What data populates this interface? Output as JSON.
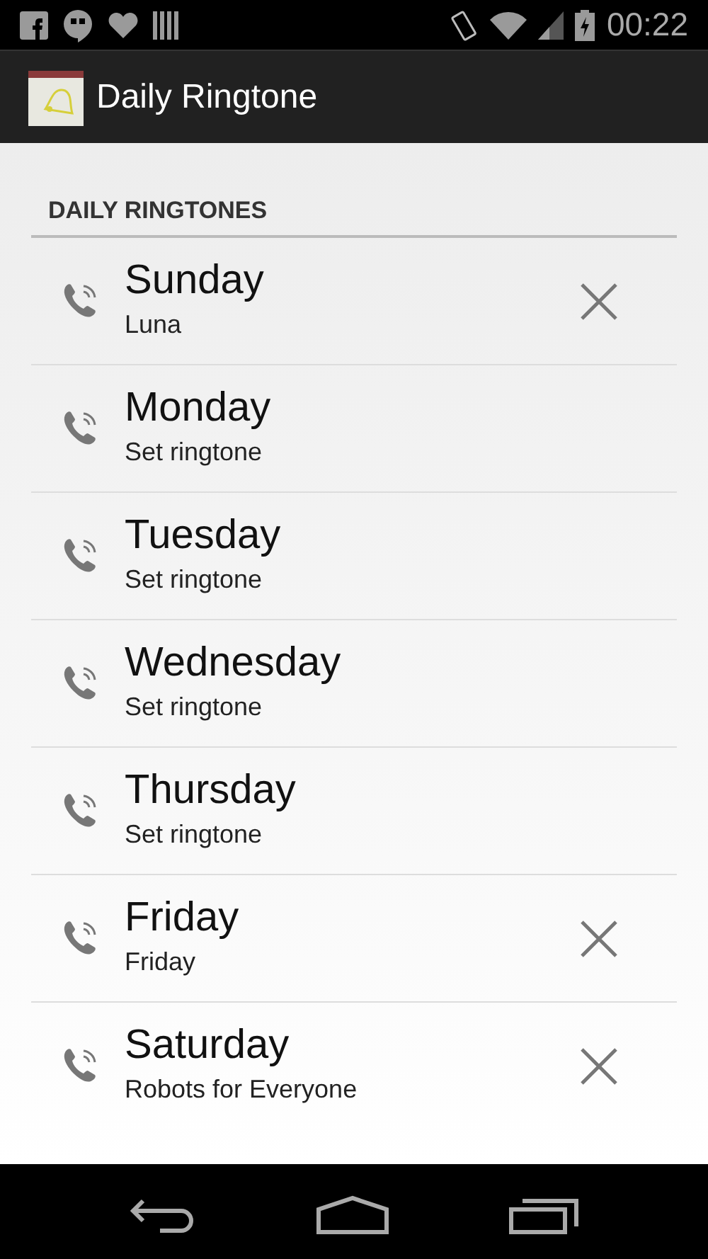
{
  "status_bar": {
    "time": "00:22"
  },
  "action_bar": {
    "title": "Daily Ringtone"
  },
  "section": {
    "title": "DAILY RINGTONES"
  },
  "days": [
    {
      "name": "Sunday",
      "ringtone": "Luna",
      "clearable": true
    },
    {
      "name": "Monday",
      "ringtone": "Set ringtone",
      "clearable": false
    },
    {
      "name": "Tuesday",
      "ringtone": "Set ringtone",
      "clearable": false
    },
    {
      "name": "Wednesday",
      "ringtone": "Set ringtone",
      "clearable": false
    },
    {
      "name": "Thursday",
      "ringtone": "Set ringtone",
      "clearable": false
    },
    {
      "name": "Friday",
      "ringtone": "Friday",
      "clearable": true
    },
    {
      "name": "Saturday",
      "ringtone": "Robots for Everyone",
      "clearable": true
    }
  ]
}
